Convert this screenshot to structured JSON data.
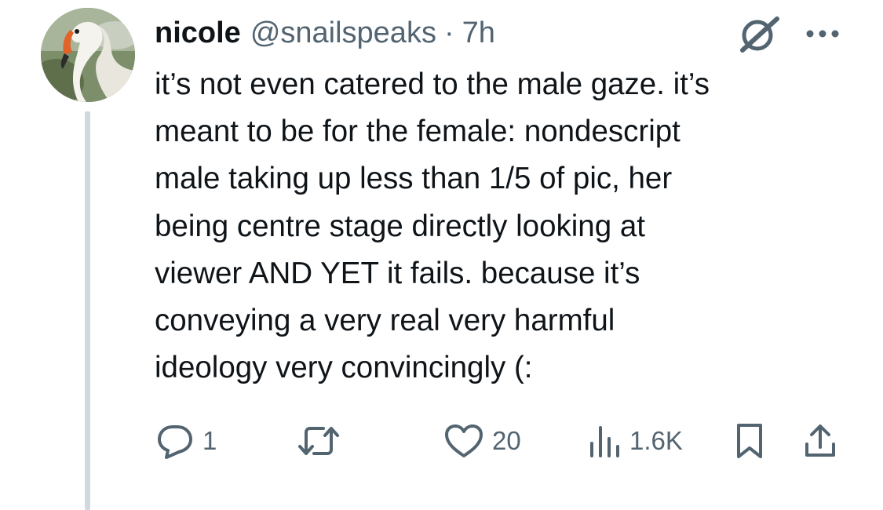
{
  "tweet": {
    "display_name": "nicole",
    "handle": "@snailspeaks",
    "separator": "·",
    "time": "7h",
    "avatar_icon": "swan-avatar-icon",
    "lines": [
      "it’s not even catered to the male gaze. it’s",
      "meant to be for the female: nondescript",
      "male taking up less than 1/5 of pic, her",
      "being centre stage directly looking at",
      "viewer AND YET it fails. because it’s",
      "conveying a very real very harmful",
      "ideology very convincingly (:"
    ]
  },
  "actions": {
    "reply": {
      "icon": "reply-icon",
      "count": "1"
    },
    "retweet": {
      "icon": "retweet-icon",
      "count": ""
    },
    "like": {
      "icon": "heart-icon",
      "count": "20"
    },
    "views": {
      "icon": "views-icon",
      "count": "1.6K"
    },
    "bookmark": {
      "icon": "bookmark-icon"
    },
    "share": {
      "icon": "share-icon"
    }
  },
  "colors": {
    "text": "#0f1419",
    "secondary": "#536471",
    "thread_line": "#cfd9de",
    "background": "#ffffff"
  }
}
